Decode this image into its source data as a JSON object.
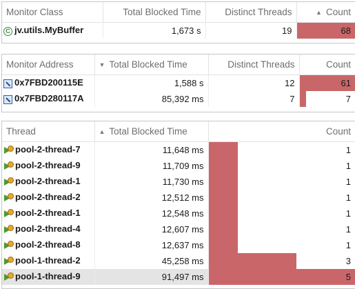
{
  "colors": {
    "bar": "#c96669",
    "selected_row": "#e4e4e4"
  },
  "monitor_class_table": {
    "columns": {
      "name": "Monitor Class",
      "blocked": "Total Blocked Time",
      "threads": "Distinct Threads",
      "count": "Count"
    },
    "sort": {
      "column": "count",
      "icon": "sort-ascending-icon"
    },
    "rows": [
      {
        "name": "jv.utils.MyBuffer",
        "icon": "class-icon",
        "blocked": "1,673 s",
        "threads": "19",
        "count": 68,
        "count_fraction": 1.0
      }
    ]
  },
  "monitor_address_table": {
    "columns": {
      "name": "Monitor Address",
      "blocked": "Total Blocked Time",
      "threads": "Distinct Threads",
      "count": "Count"
    },
    "sort": {
      "column": "blocked",
      "icon": "sort-descending-icon"
    },
    "rows": [
      {
        "name": "0x7FBD200115E",
        "icon": "address-icon",
        "blocked": "1,588 s",
        "threads": "12",
        "count": 61,
        "count_fraction": 1.0
      },
      {
        "name": "0x7FBD280117A",
        "icon": "address-icon",
        "blocked": "85,392 ms",
        "threads": "7",
        "count": 7,
        "count_fraction": 0.115
      }
    ]
  },
  "thread_table": {
    "columns": {
      "name": "Thread",
      "blocked": "Total Blocked Time",
      "count": "Count"
    },
    "sort": {
      "column": "blocked",
      "icon": "sort-ascending-icon"
    },
    "rows": [
      {
        "name": "pool-2-thread-7",
        "icon": "thread-icon",
        "blocked": "11,648 ms",
        "count": 1,
        "count_fraction": 0.2
      },
      {
        "name": "pool-2-thread-9",
        "icon": "thread-icon",
        "blocked": "11,709 ms",
        "count": 1,
        "count_fraction": 0.2
      },
      {
        "name": "pool-2-thread-1",
        "icon": "thread-icon",
        "blocked": "11,730 ms",
        "count": 1,
        "count_fraction": 0.2
      },
      {
        "name": "pool-2-thread-2",
        "icon": "thread-icon",
        "blocked": "12,512 ms",
        "count": 1,
        "count_fraction": 0.2
      },
      {
        "name": "pool-2-thread-1",
        "icon": "thread-icon",
        "blocked": "12,548 ms",
        "count": 1,
        "count_fraction": 0.2
      },
      {
        "name": "pool-2-thread-4",
        "icon": "thread-icon",
        "blocked": "12,607 ms",
        "count": 1,
        "count_fraction": 0.2
      },
      {
        "name": "pool-2-thread-8",
        "icon": "thread-icon",
        "blocked": "12,637 ms",
        "count": 1,
        "count_fraction": 0.2
      },
      {
        "name": "pool-1-thread-2",
        "icon": "thread-icon",
        "blocked": "45,258 ms",
        "count": 3,
        "count_fraction": 0.6
      },
      {
        "name": "pool-1-thread-9",
        "icon": "thread-icon",
        "blocked": "91,497 ms",
        "count": 5,
        "count_fraction": 1.0,
        "selected": true
      }
    ]
  }
}
